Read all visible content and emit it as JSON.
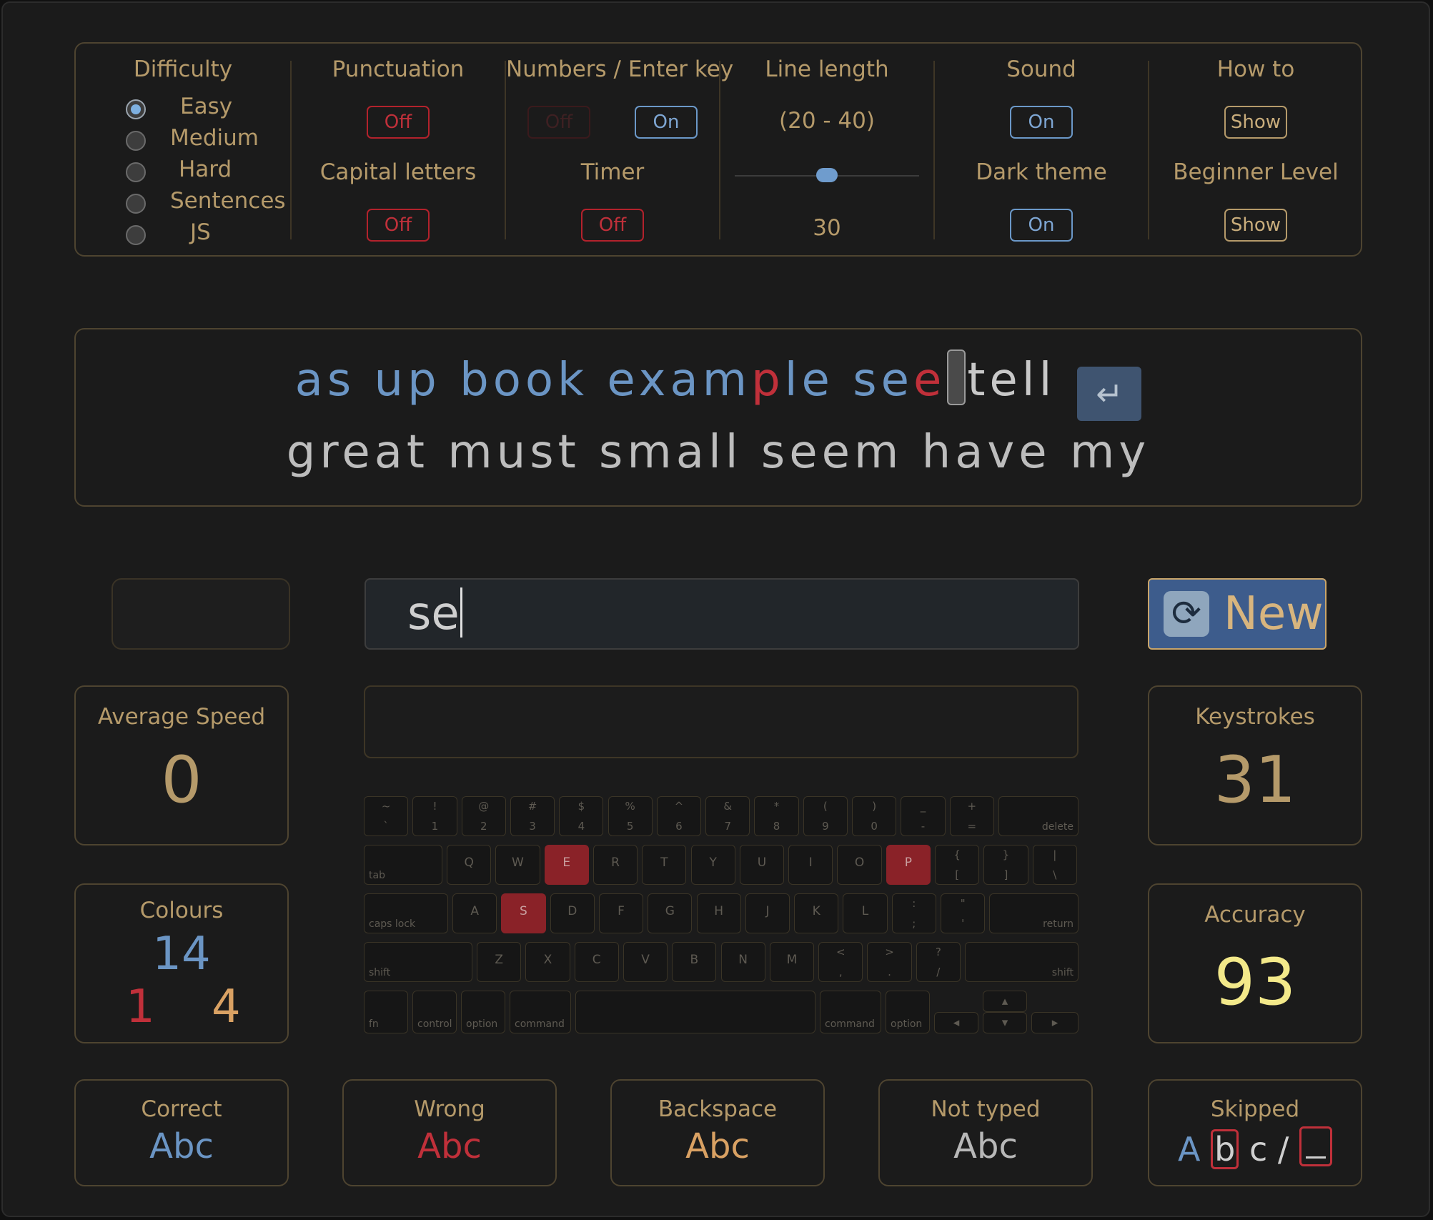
{
  "settings": {
    "difficulty": {
      "label": "Difficulty",
      "options": [
        "Easy",
        "Medium",
        "Hard",
        "Sentences",
        "JS"
      ],
      "selected": "Easy"
    },
    "punctuation": {
      "label": "Punctuation",
      "value": "Off"
    },
    "capital_letters": {
      "label": "Capital letters",
      "value": "Off"
    },
    "numbers_enter": {
      "label": "Numbers / Enter key",
      "numbers_value": "Off",
      "enter_value": "On"
    },
    "timer": {
      "label": "Timer",
      "value": "Off"
    },
    "line_length": {
      "label": "Line length",
      "range": "(20 - 40)",
      "value": "30",
      "slider_fraction": 0.5
    },
    "sound": {
      "label": "Sound",
      "value": "On"
    },
    "dark_theme": {
      "label": "Dark theme",
      "value": "On"
    },
    "how_to": {
      "label": "How to",
      "button": "Show"
    },
    "beginner_level": {
      "label": "Beginner Level",
      "button": "Show"
    }
  },
  "display": {
    "line1": {
      "words": [
        "as",
        "up",
        "book",
        "exam",
        "p",
        "le",
        "se",
        "e",
        "tell"
      ],
      "segments": [
        {
          "text": "as up book exam",
          "state": "correct"
        },
        {
          "text": "p",
          "state": "wrong"
        },
        {
          "text": "le se",
          "state": "correct"
        },
        {
          "text": "e",
          "state": "wrong"
        },
        {
          "text": "tell",
          "state": "not-typed"
        }
      ],
      "enter_symbol": "↵"
    },
    "line2": "great must small seem have my"
  },
  "input": {
    "value": "se"
  },
  "new_button": {
    "label": "New",
    "icon": "refresh-icon"
  },
  "stats": {
    "average_speed": {
      "label": "Average Speed",
      "value": "0"
    },
    "keystrokes": {
      "label": "Keystrokes",
      "value": "31"
    },
    "colours": {
      "label": "Colours",
      "correct": "14",
      "wrong": "1",
      "backspace": "4"
    },
    "accuracy": {
      "label": "Accuracy",
      "value": "93"
    }
  },
  "legend": {
    "correct": {
      "label": "Correct",
      "sample": "Abc"
    },
    "wrong": {
      "label": "Wrong",
      "sample": "Abc"
    },
    "backspace": {
      "label": "Backspace",
      "sample": "Abc"
    },
    "not_typed": {
      "label": "Not typed",
      "sample": "Abc"
    },
    "skipped": {
      "label": "Skipped",
      "a": "A",
      "b": "b",
      "c": "c",
      "slash": "/"
    }
  },
  "keyboard": {
    "highlighted": [
      "E",
      "P",
      "S"
    ],
    "row1": [
      [
        "~",
        "`"
      ],
      [
        "!",
        "1"
      ],
      [
        "@",
        "2"
      ],
      [
        "#",
        "3"
      ],
      [
        "$",
        "4"
      ],
      [
        "%",
        "5"
      ],
      [
        "^",
        "6"
      ],
      [
        "&",
        "7"
      ],
      [
        "*",
        "8"
      ],
      [
        "(",
        "9"
      ],
      [
        ")",
        "0"
      ],
      [
        "_",
        "-"
      ],
      [
        "+",
        "="
      ]
    ],
    "row1_end": "delete",
    "row2_start": "tab",
    "row2": [
      "Q",
      "W",
      "E",
      "R",
      "T",
      "Y",
      "U",
      "I",
      "O",
      "P"
    ],
    "row2_end": [
      [
        "{",
        "["
      ],
      [
        "}",
        "]"
      ],
      [
        "|",
        "\\"
      ]
    ],
    "row3_start": "caps lock",
    "row3": [
      "A",
      "S",
      "D",
      "F",
      "G",
      "H",
      "J",
      "K",
      "L"
    ],
    "row3_punct": [
      [
        ":",
        ";"
      ],
      [
        "\"",
        "'"
      ]
    ],
    "row3_end": "return",
    "row4_start": "shift",
    "row4": [
      "Z",
      "X",
      "C",
      "V",
      "B",
      "N",
      "M"
    ],
    "row4_punct": [
      [
        "<",
        ","
      ],
      [
        ">",
        "."
      ],
      [
        "?",
        "/"
      ]
    ],
    "row4_end": "shift",
    "row5": [
      "fn",
      "control",
      "option",
      "command",
      "command",
      "option"
    ],
    "arrows": [
      "◂",
      "▴",
      "▾",
      "▸"
    ]
  },
  "colors": {
    "correct": "#6b95c4",
    "wrong": "#c0303a",
    "backspace": "#d9a163",
    "not_typed": "#b8b8b8",
    "accent_gold": "#b59a6a",
    "accuracy": "#f3e98a"
  }
}
